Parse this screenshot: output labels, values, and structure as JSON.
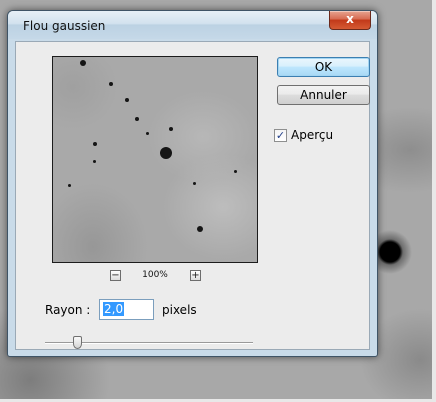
{
  "dialog": {
    "title": "Flou gaussien",
    "close_glyph": "x"
  },
  "preview": {
    "zoom_level": "100%",
    "zoom_out_glyph": "−",
    "zoom_in_glyph": "+"
  },
  "buttons": {
    "ok_label": "OK",
    "cancel_label": "Annuler"
  },
  "preview_toggle": {
    "label": "Aperçu",
    "checked": true,
    "check_glyph": "✓"
  },
  "radius": {
    "label": "Rayon :",
    "value": "2,0",
    "unit": "pixels",
    "slider_fraction": 0.14
  },
  "colors": {
    "title_bar": "#c9dbe9",
    "close_button": "#c2391a",
    "selection": "#3399ff",
    "default_button_border": "#3c7fb1"
  }
}
